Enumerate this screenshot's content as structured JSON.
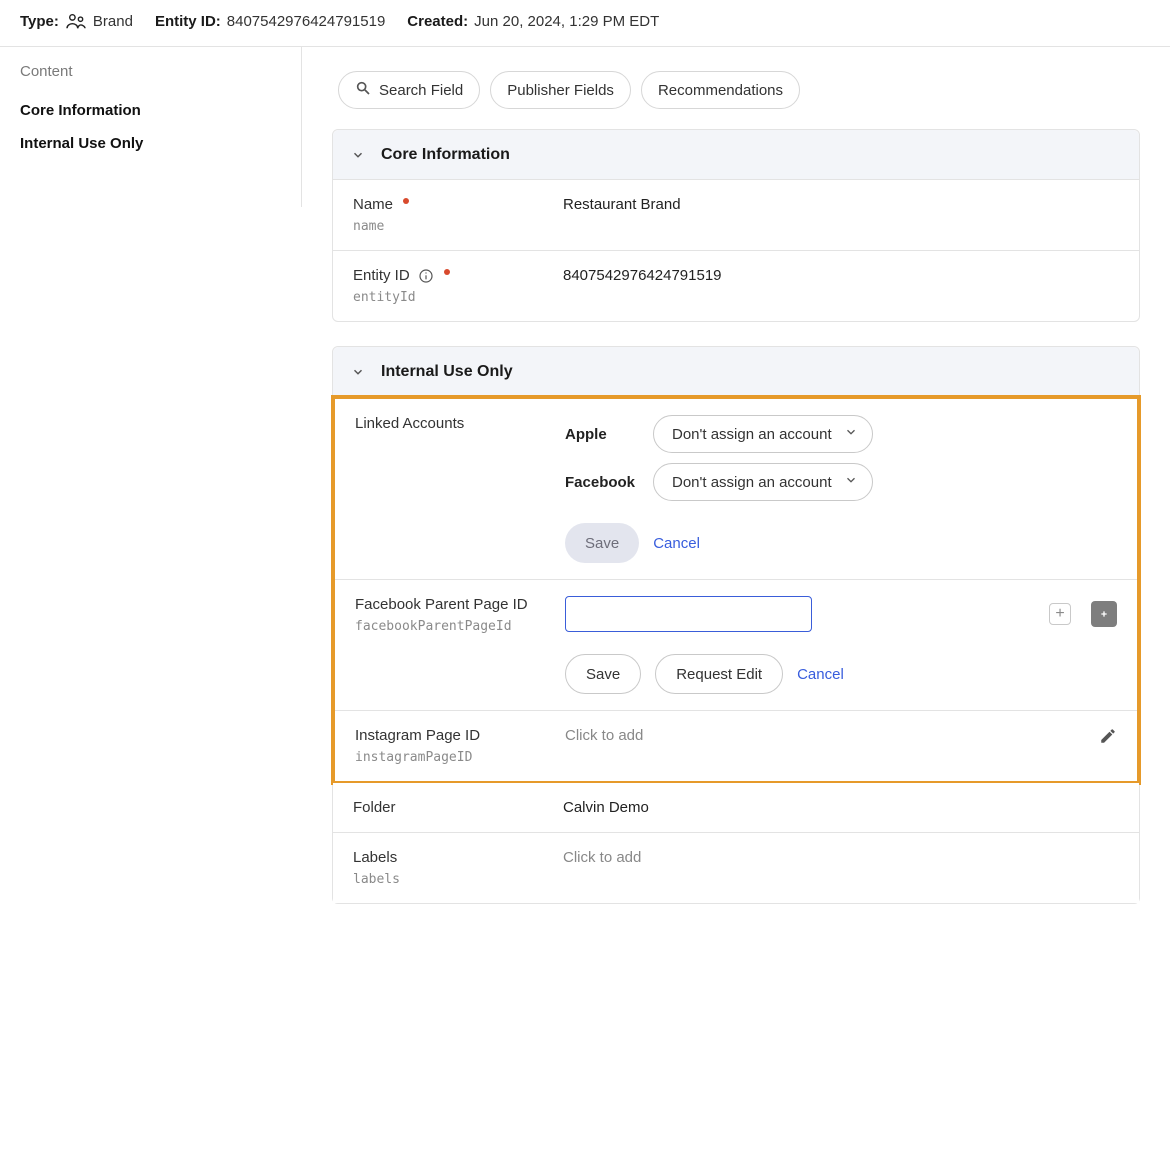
{
  "topbar": {
    "type_label": "Type:",
    "type_value": "Brand",
    "entity_id_label": "Entity ID:",
    "entity_id_value": "8407542976424791519",
    "created_label": "Created:",
    "created_value": "Jun 20, 2024, 1:29 PM EDT"
  },
  "sidebar": {
    "heading": "Content",
    "items": [
      {
        "label": "Core Information"
      },
      {
        "label": "Internal Use Only"
      }
    ]
  },
  "pills": {
    "search_field": "Search Field",
    "publisher_fields": "Publisher Fields",
    "recommendations": "Recommendations"
  },
  "sections": {
    "core": {
      "title": "Core Information",
      "fields": {
        "name": {
          "label": "Name",
          "api": "name",
          "value": "Restaurant Brand",
          "required": true
        },
        "entity_id": {
          "label": "Entity ID",
          "api": "entityId",
          "value": "8407542976424791519",
          "required": true
        }
      }
    },
    "internal": {
      "title": "Internal Use Only",
      "linked_accounts": {
        "label": "Linked Accounts",
        "providers": [
          {
            "name": "Apple",
            "selected": "Don't assign an account"
          },
          {
            "name": "Facebook",
            "selected": "Don't assign an account"
          }
        ],
        "save_label": "Save",
        "cancel_label": "Cancel"
      },
      "fb_parent": {
        "label": "Facebook Parent Page ID",
        "api": "facebookParentPageId",
        "value": "",
        "save_label": "Save",
        "request_edit_label": "Request Edit",
        "cancel_label": "Cancel"
      },
      "instagram": {
        "label": "Instagram Page ID",
        "api": "instagramPageID",
        "placeholder": "Click to add"
      },
      "folder": {
        "label": "Folder",
        "value": "Calvin Demo"
      },
      "labels": {
        "label": "Labels",
        "api": "labels",
        "placeholder": "Click to add"
      }
    }
  }
}
